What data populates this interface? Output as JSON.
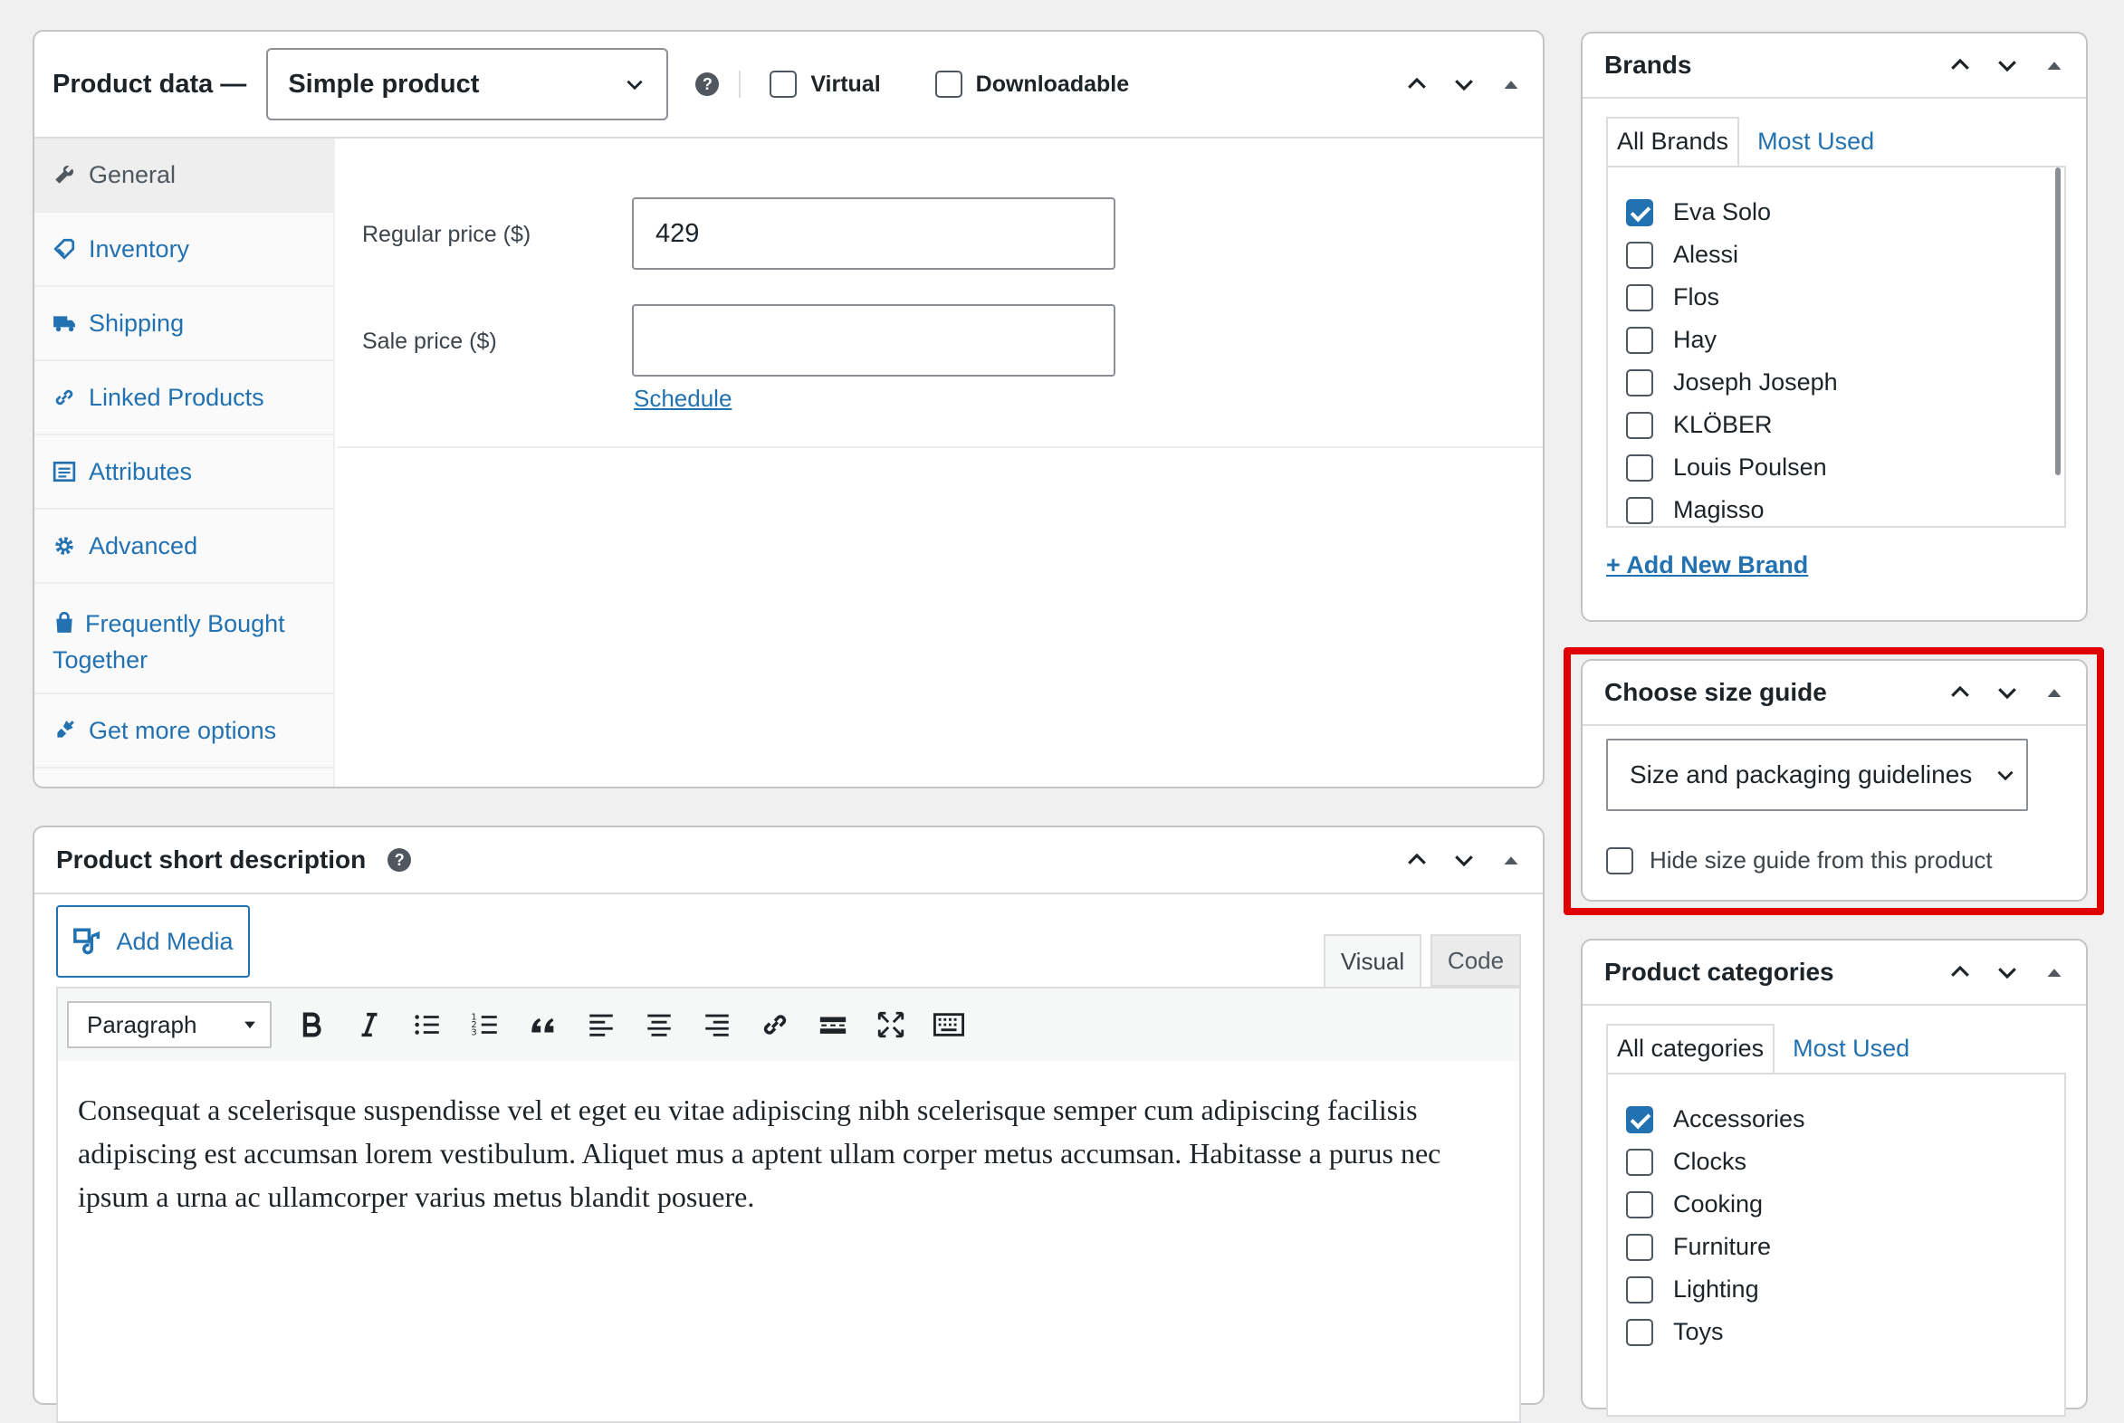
{
  "product_data": {
    "title": "Product data —",
    "type_select": "Simple product",
    "virtual_label": "Virtual",
    "downloadable_label": "Downloadable",
    "tabs": [
      {
        "label": "General"
      },
      {
        "label": "Inventory"
      },
      {
        "label": "Shipping"
      },
      {
        "label": "Linked Products"
      },
      {
        "label": "Attributes"
      },
      {
        "label": "Advanced"
      },
      {
        "label": "Frequently Bought Together"
      },
      {
        "label": "Get more options"
      }
    ],
    "regular_price_label": "Regular price ($)",
    "regular_price_value": "429",
    "sale_price_label": "Sale price ($)",
    "sale_price_value": "",
    "schedule_link": "Schedule"
  },
  "short_description": {
    "title": "Product short description",
    "add_media": "Add Media",
    "tab_visual": "Visual",
    "tab_code": "Code",
    "format_select": "Paragraph",
    "text": "Consequat a scelerisque suspendisse vel et eget eu vitae adipiscing nibh scelerisque semper cum adipiscing facilisis adipiscing est accumsan lorem vestibulum. Aliquet mus a aptent ullam corper metus accumsan. Habitasse a purus nec ipsum a urna ac ullamcorper varius metus blandit posuere."
  },
  "brands": {
    "title": "Brands",
    "tab_all": "All Brands",
    "tab_most_used": "Most Used",
    "items": [
      {
        "label": "Eva Solo",
        "checked": true
      },
      {
        "label": "Alessi",
        "checked": false
      },
      {
        "label": "Flos",
        "checked": false
      },
      {
        "label": "Hay",
        "checked": false
      },
      {
        "label": "Joseph Joseph",
        "checked": false
      },
      {
        "label": "KLÖBER",
        "checked": false
      },
      {
        "label": "Louis Poulsen",
        "checked": false
      },
      {
        "label": "Magisso",
        "checked": false
      }
    ],
    "add_new": "+ Add New Brand"
  },
  "size_guide": {
    "title": "Choose size guide",
    "select_value": "Size and packaging guidelines",
    "hide_label": "Hide size guide from this product",
    "highlight_color": "#e00000"
  },
  "categories": {
    "title": "Product categories",
    "tab_all": "All categories",
    "tab_most_used": "Most Used",
    "items": [
      {
        "label": "Accessories",
        "checked": true
      },
      {
        "label": "Clocks",
        "checked": false
      },
      {
        "label": "Cooking",
        "checked": false
      },
      {
        "label": "Furniture",
        "checked": false
      },
      {
        "label": "Lighting",
        "checked": false
      },
      {
        "label": "Toys",
        "checked": false
      }
    ]
  },
  "colors": {
    "accent": "#2271b1",
    "checkbox_checked": "#2271b1",
    "background": "#f0f0f1"
  }
}
